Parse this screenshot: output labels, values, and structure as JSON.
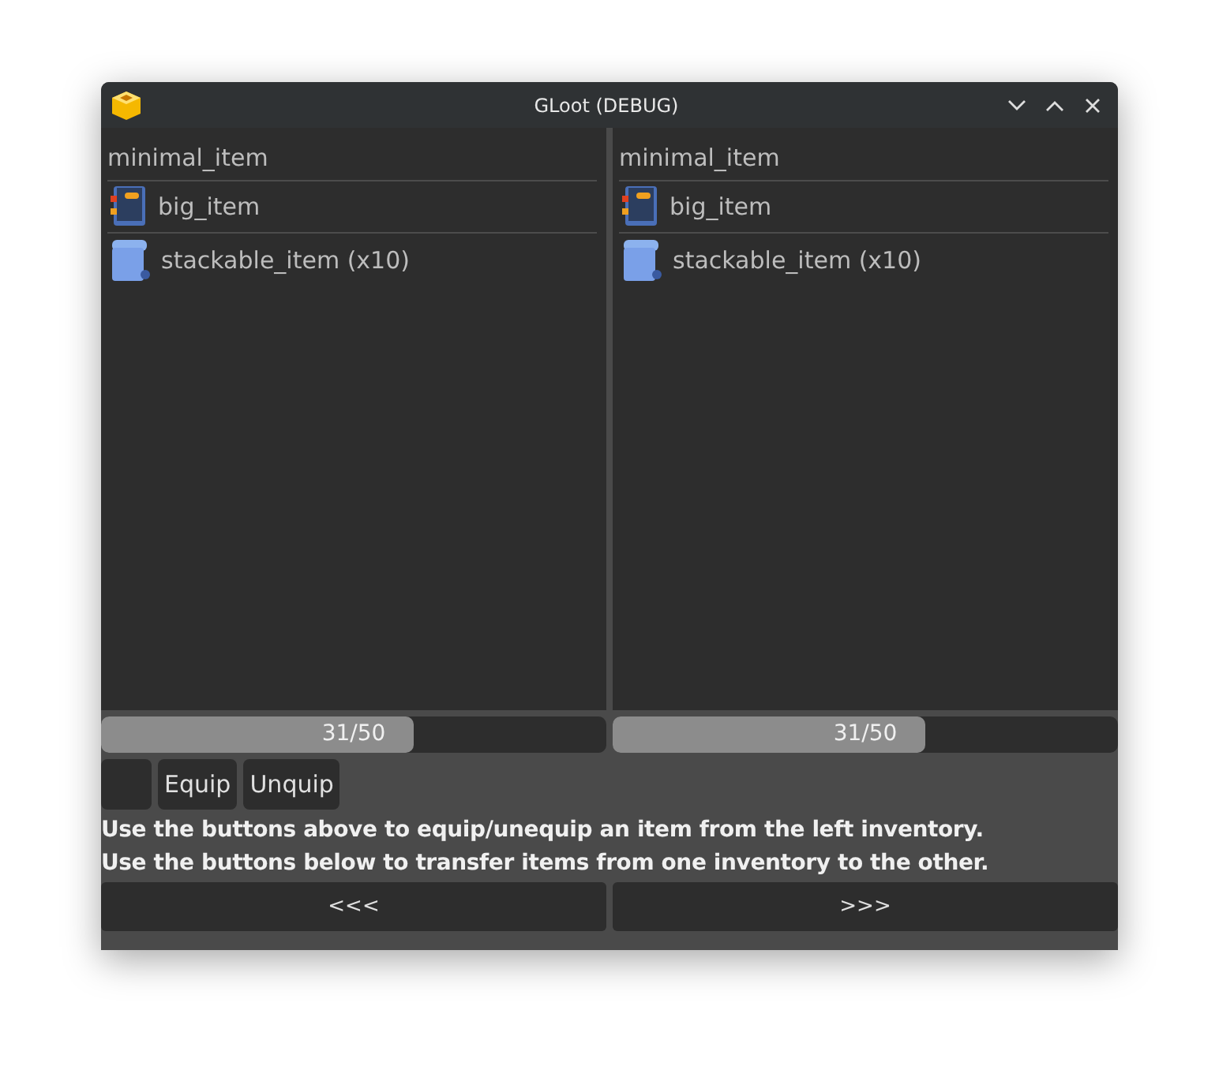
{
  "window": {
    "title": "GLoot (DEBUG)"
  },
  "inventories": [
    {
      "items": [
        {
          "kind": "text",
          "label": "minimal_item"
        },
        {
          "kind": "book",
          "label": "big_item"
        },
        {
          "kind": "scroll",
          "label": "stackable_item (x10)"
        }
      ],
      "capacity": {
        "reading": "31/50",
        "level": 0.62
      }
    },
    {
      "items": [
        {
          "kind": "text",
          "label": "minimal_item"
        },
        {
          "kind": "book",
          "label": "big_item"
        },
        {
          "kind": "scroll",
          "label": "stackable_item (x10)"
        }
      ],
      "capacity": {
        "reading": "31/50",
        "level": 0.62
      }
    }
  ],
  "equip_buttons": [
    "Equip",
    "Unquip"
  ],
  "instructions": [
    "Use the buttons above to equip/unequip an item from the left inventory.",
    "Use the buttons below to transfer items from one inventory to the other."
  ],
  "transfer_buttons": [
    "<<<",
    ">>>"
  ]
}
